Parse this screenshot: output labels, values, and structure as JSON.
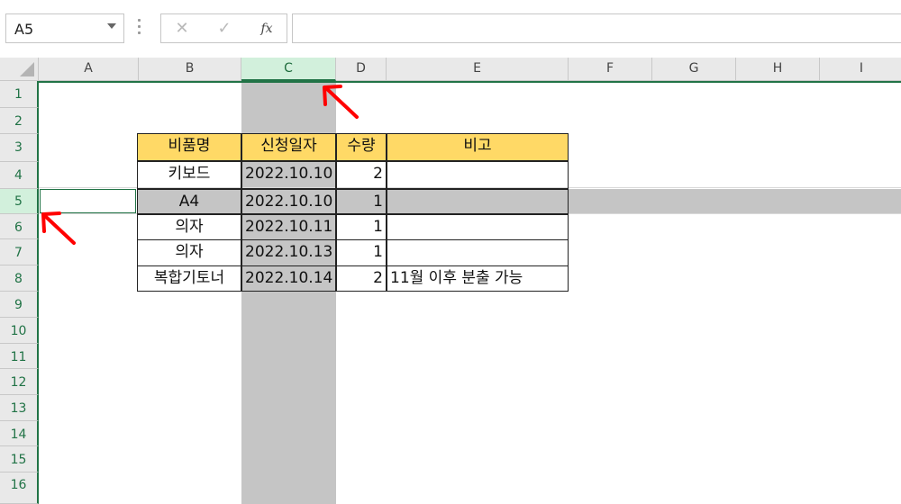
{
  "formula_bar": {
    "name_box": "A5",
    "cancel_icon": "✕",
    "enter_icon": "✓",
    "fx_label": "fx",
    "formula": ""
  },
  "columns": [
    "A",
    "B",
    "C",
    "D",
    "E",
    "F",
    "G",
    "H",
    "I"
  ],
  "rows": [
    "1",
    "2",
    "3",
    "4",
    "5",
    "6",
    "7",
    "8",
    "9",
    "10",
    "11",
    "12",
    "13",
    "14",
    "15",
    "16"
  ],
  "selected_column": "C",
  "selected_row": "5",
  "table": {
    "headers": [
      "비품명",
      "신청일자",
      "수량",
      "비고"
    ],
    "rows": [
      {
        "item": "키보드",
        "date": "2022.10.10",
        "qty": "2",
        "note": ""
      },
      {
        "item": "A4",
        "date": "2022.10.10",
        "qty": "1",
        "note": ""
      },
      {
        "item": "의자",
        "date": "2022.10.11",
        "qty": "1",
        "note": ""
      },
      {
        "item": "의자",
        "date": "2022.10.13",
        "qty": "1",
        "note": ""
      },
      {
        "item": "복합기토너",
        "date": "2022.10.14",
        "qty": "2",
        "note": "11월 이후 분출 가능"
      }
    ]
  },
  "colors": {
    "header_fill": "#ffd966",
    "selection_gray": "#c5c5c5",
    "excel_green": "#217346",
    "arrow_red": "#ff0000"
  }
}
